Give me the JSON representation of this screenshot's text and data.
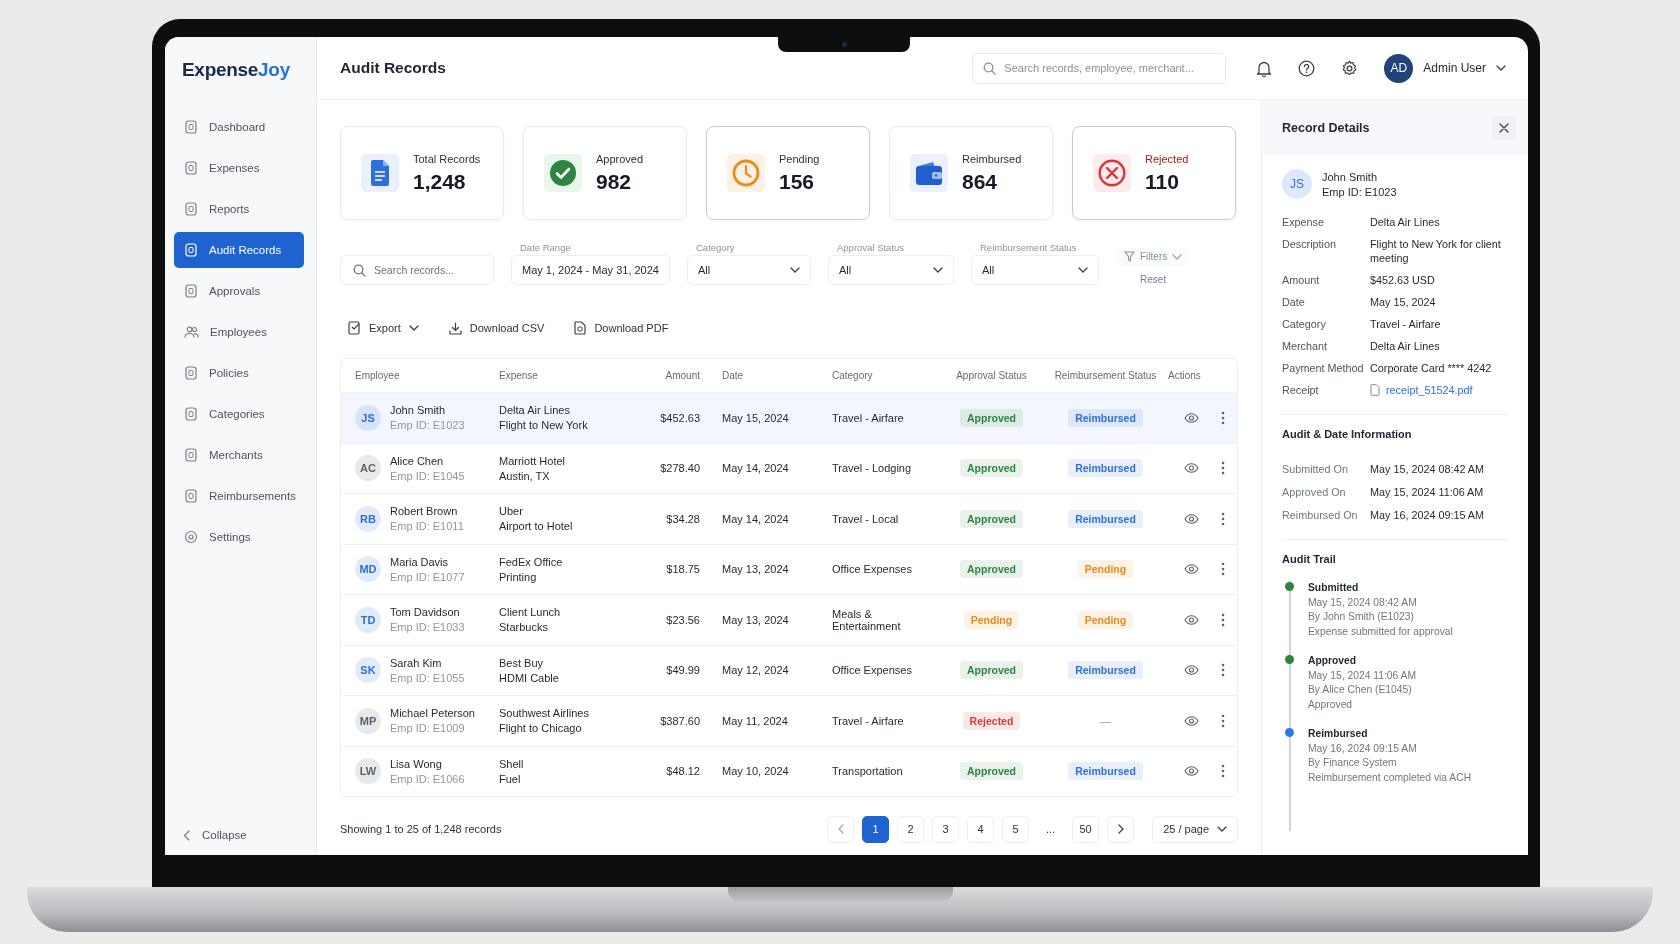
{
  "logo": {
    "first": "Expense",
    "second": "Joy"
  },
  "sidebar": {
    "items": [
      {
        "label": "Dashboard",
        "kind": "doc",
        "selected": false
      },
      {
        "label": "Expenses",
        "kind": "doc",
        "selected": false
      },
      {
        "label": "Reports",
        "kind": "doc",
        "selected": false
      },
      {
        "label": "Audit Records",
        "kind": "doc",
        "selected": true
      },
      {
        "label": "Approvals",
        "kind": "doc",
        "selected": false
      },
      {
        "label": "Employees",
        "kind": "people",
        "selected": false
      },
      {
        "label": "Policies",
        "kind": "doc",
        "selected": false
      },
      {
        "label": "Categories",
        "kind": "doc",
        "selected": false
      },
      {
        "label": "Merchants",
        "kind": "doc",
        "selected": false
      },
      {
        "label": "Reimbursements",
        "kind": "doc",
        "selected": false
      },
      {
        "label": "Settings",
        "kind": "gear",
        "selected": false
      }
    ],
    "collapse": "Collapse"
  },
  "header": {
    "title": "Audit Records",
    "search_placeholder": "Search records, employee, merchant...",
    "avatar": "AD",
    "user": "Admin User"
  },
  "stats": [
    {
      "kind": "total",
      "label": "Total Records",
      "value": "1,248"
    },
    {
      "kind": "approved",
      "label": "Approved",
      "value": "982"
    },
    {
      "kind": "pending",
      "label": "Pending",
      "value": "156"
    },
    {
      "kind": "reimbursed",
      "label": "Reimbursed",
      "value": "864"
    },
    {
      "kind": "rejected",
      "label": "Rejected",
      "value": "110"
    }
  ],
  "filters": {
    "search_placeholder": "Search records...",
    "fields": [
      {
        "label": "Date Range",
        "value": "May 1, 2024 - May 31, 2024",
        "kind": "date"
      },
      {
        "label": "Category",
        "value": "All",
        "kind": "select"
      },
      {
        "label": "Approval Status",
        "value": "All",
        "kind": "select"
      },
      {
        "label": "Reimbursement Status",
        "value": "All",
        "kind": "select"
      }
    ],
    "filters_button": "Filters",
    "reset": "Reset"
  },
  "toolbar": [
    {
      "kind": "export",
      "label": "Export"
    },
    {
      "kind": "csv",
      "label": "Download CSV"
    },
    {
      "kind": "pdf",
      "label": "Download PDF"
    }
  ],
  "table": {
    "columns": [
      "Employee",
      "Expense",
      "Amount",
      "Date",
      "Category",
      "Approval Status",
      "Reimbursement Status",
      "Actions"
    ],
    "rows": [
      {
        "avatar": {
          "initials": "JS",
          "color": "#2f6fd6"
        },
        "name": "John Smith",
        "emp_id": "Emp ID: E1023",
        "expense": "Delta Air Lines",
        "detail": "Flight to New York",
        "amount": "$452.63",
        "date": "May 15, 2024",
        "category": "Travel - Airfare",
        "approval": {
          "text": "Approved",
          "color": "#2e8540"
        },
        "reimbursement": {
          "text": "Reimbursed",
          "color": "#2f6fd6"
        },
        "selected": true
      },
      {
        "avatar": {
          "initials": "AC",
          "color": "#5b6270"
        },
        "name": "Alice Chen",
        "emp_id": "Emp ID: E1045",
        "expense": "Marriott Hotel",
        "detail": "Austin, TX",
        "amount": "$278.40",
        "date": "May 14, 2024",
        "category": "Travel - Lodging",
        "approval": {
          "text": "Approved",
          "color": "#2e8540"
        },
        "reimbursement": {
          "text": "Reimbursed",
          "color": "#2f6fd6"
        },
        "selected": false
      },
      {
        "avatar": {
          "initials": "RB",
          "color": "#2f6fd6"
        },
        "name": "Robert Brown",
        "emp_id": "Emp ID: E1011",
        "expense": "Uber",
        "detail": "Airport to Hotel",
        "amount": "$34.28",
        "date": "May 14, 2024",
        "category": "Travel - Local",
        "approval": {
          "text": "Approved",
          "color": "#2e8540"
        },
        "reimbursement": {
          "text": "Reimbursed",
          "color": "#2f6fd6"
        },
        "selected": false
      },
      {
        "avatar": {
          "initials": "MD",
          "color": "#2f6fd6"
        },
        "name": "Maria Davis",
        "emp_id": "Emp ID: E1077",
        "expense": "FedEx Office",
        "detail": "Printing",
        "amount": "$18.75",
        "date": "May 13, 2024",
        "category": "Office Expenses",
        "approval": {
          "text": "Approved",
          "color": "#2e8540"
        },
        "reimbursement": {
          "text": "Pending",
          "color": "#e8891a"
        },
        "selected": false
      },
      {
        "avatar": {
          "initials": "TD",
          "color": "#2f6fd6"
        },
        "name": "Tom Davidson",
        "emp_id": "Emp ID: E1033",
        "expense": "Client Lunch",
        "detail": "Starbucks",
        "amount": "$23.56",
        "date": "May 13, 2024",
        "category": "Meals & Entertainment",
        "approval": {
          "text": "Pending",
          "color": "#e8891a"
        },
        "reimbursement": {
          "text": "Pending",
          "color": "#e8891a"
        },
        "selected": false
      },
      {
        "avatar": {
          "initials": "SK",
          "color": "#2f6fd6"
        },
        "name": "Sarah Kim",
        "emp_id": "Emp ID: E1055",
        "expense": "Best Buy",
        "detail": "HDMI Cable",
        "amount": "$49.99",
        "date": "May 12, 2024",
        "category": "Office Expenses",
        "approval": {
          "text": "Approved",
          "color": "#2e8540"
        },
        "reimbursement": {
          "text": "Reimbursed",
          "color": "#2f6fd6"
        },
        "selected": false
      },
      {
        "avatar": {
          "initials": "MP",
          "color": "#5b6270"
        },
        "name": "Michael Peterson",
        "emp_id": "Emp ID: E1009",
        "expense": "Southwest Airlines",
        "detail": "Flight to Chicago",
        "amount": "$387.60",
        "date": "May 11, 2024",
        "category": "Travel - Airfare",
        "approval": {
          "text": "Rejected",
          "color": "#d93a3a"
        },
        "reimbursement": {
          "text": "—"
        },
        "selected": false
      },
      {
        "avatar": {
          "initials": "LW",
          "color": "#5b6270"
        },
        "name": "Lisa Wong",
        "emp_id": "Emp ID: E1066",
        "expense": "Shell",
        "detail": "Fuel",
        "amount": "$48.12",
        "date": "May 10, 2024",
        "category": "Transportation",
        "approval": {
          "text": "Approved",
          "color": "#2e8540"
        },
        "reimbursement": {
          "text": "Reimbursed",
          "color": "#2f6fd6"
        },
        "selected": false
      }
    ]
  },
  "pagination": {
    "summary": "Showing 1 to 25 of 1,248 records",
    "pages": [
      {
        "label": "1",
        "kind": "page",
        "selected": true
      },
      {
        "label": "2",
        "kind": "page",
        "selected": false
      },
      {
        "label": "3",
        "kind": "page",
        "selected": false
      },
      {
        "label": "4",
        "kind": "page",
        "selected": false
      },
      {
        "label": "5",
        "kind": "page",
        "selected": false
      },
      {
        "label": "...",
        "kind": "gap"
      },
      {
        "label": "50",
        "kind": "page",
        "selected": false
      }
    ],
    "per_page": "25 / page"
  },
  "details": {
    "title": "Record Details",
    "initials": "JS",
    "name": "John Smith",
    "emp_id": "Emp ID: E1023",
    "fields": [
      {
        "label": "Expense",
        "value": "Delta Air Lines",
        "kind": "text"
      },
      {
        "label": "Description",
        "value": "Flight to New York for client meeting",
        "kind": "text"
      },
      {
        "label": "Amount",
        "value": "$452.63 USD",
        "kind": "text"
      },
      {
        "label": "Date",
        "value": "May 15, 2024",
        "kind": "text"
      },
      {
        "label": "Category",
        "value": "Travel - Airfare",
        "kind": "text"
      },
      {
        "label": "Merchant",
        "value": "Delta Air Lines",
        "kind": "text"
      },
      {
        "label": "Payment Method",
        "value": "Corporate Card **** 4242",
        "kind": "text"
      },
      {
        "label": "Receipt",
        "value": "receipt_51524.pdf",
        "kind": "file"
      }
    ],
    "dates_title": "Audit & Date Information",
    "dates": [
      {
        "label": "Submitted On",
        "value": "May 15, 2024 08:42 AM"
      },
      {
        "label": "Approved On",
        "value": "May 15, 2024 11:06 AM"
      },
      {
        "label": "Reimbursed On",
        "value": "May 16, 2024 09:15 AM"
      }
    ],
    "trail_title": "Audit Trail",
    "trail": [
      {
        "title": "Submitted",
        "color": "#2e8540",
        "lines": [
          "May 15, 2024 08:42 AM",
          "By John Smith (E1023)",
          "Expense submitted for approval"
        ]
      },
      {
        "title": "Approved",
        "color": "#2e8540",
        "lines": [
          "May 15, 2024 11:06 AM",
          "By Alice Chen (E1045)",
          "Approved"
        ]
      },
      {
        "title": "Reimbursed",
        "color": "#2f7ae0",
        "lines": [
          "May 16, 2024 09:15 AM",
          "By Finance System",
          "Reimbursement completed via ACH"
        ]
      }
    ]
  }
}
